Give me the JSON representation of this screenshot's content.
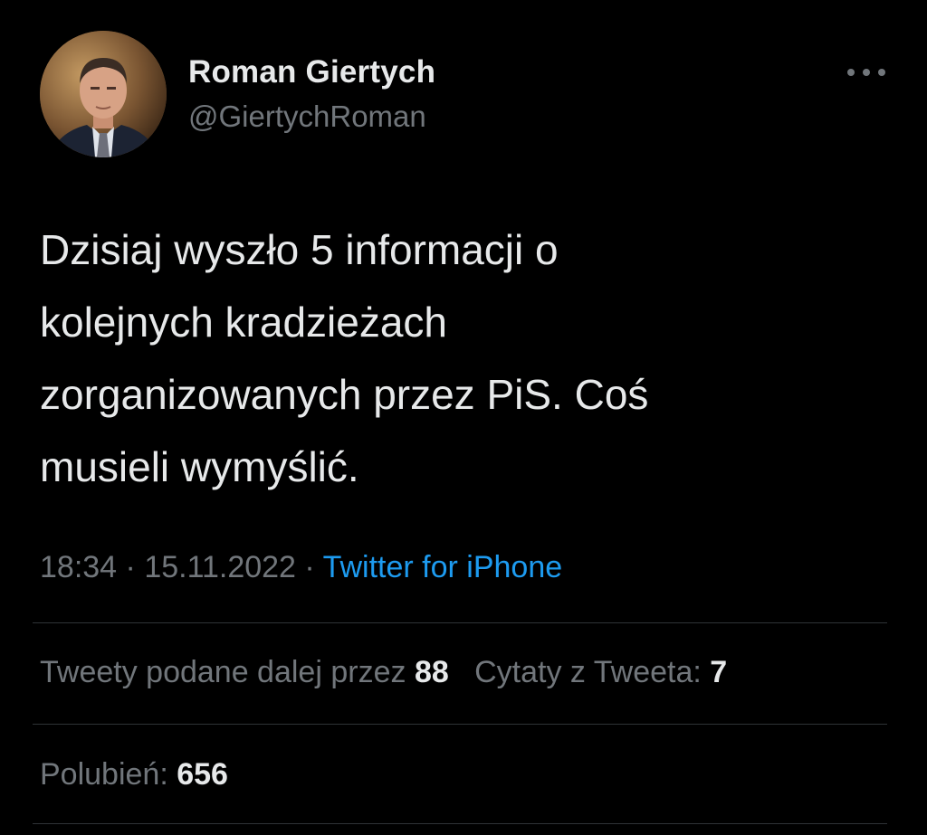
{
  "author": {
    "name": "Roman Giertych",
    "handle": "@GiertychRoman",
    "avatar_icon": "profile-photo"
  },
  "tweet": {
    "text": "Dzisiaj wyszło 5 informacji o\nkolejnych kradzieżach\nzorganizowanych przez PiS. Coś\nmusieli wymyślić."
  },
  "meta": {
    "time": "18:34",
    "separator1": " · ",
    "date": "15.11.2022",
    "separator2": " · ",
    "source": "Twitter for iPhone"
  },
  "stats": {
    "retweets_label": "Tweety podane dalej przez",
    "retweets_count": "88",
    "quotes_label": "Cytaty z Tweeta:",
    "quotes_count": "7",
    "likes_label": "Polubień:",
    "likes_count": "656"
  },
  "colors": {
    "background": "#000000",
    "text": "#e7e9ea",
    "secondary": "#71767b",
    "link": "#1d9bf0",
    "divider": "#2f3336"
  }
}
